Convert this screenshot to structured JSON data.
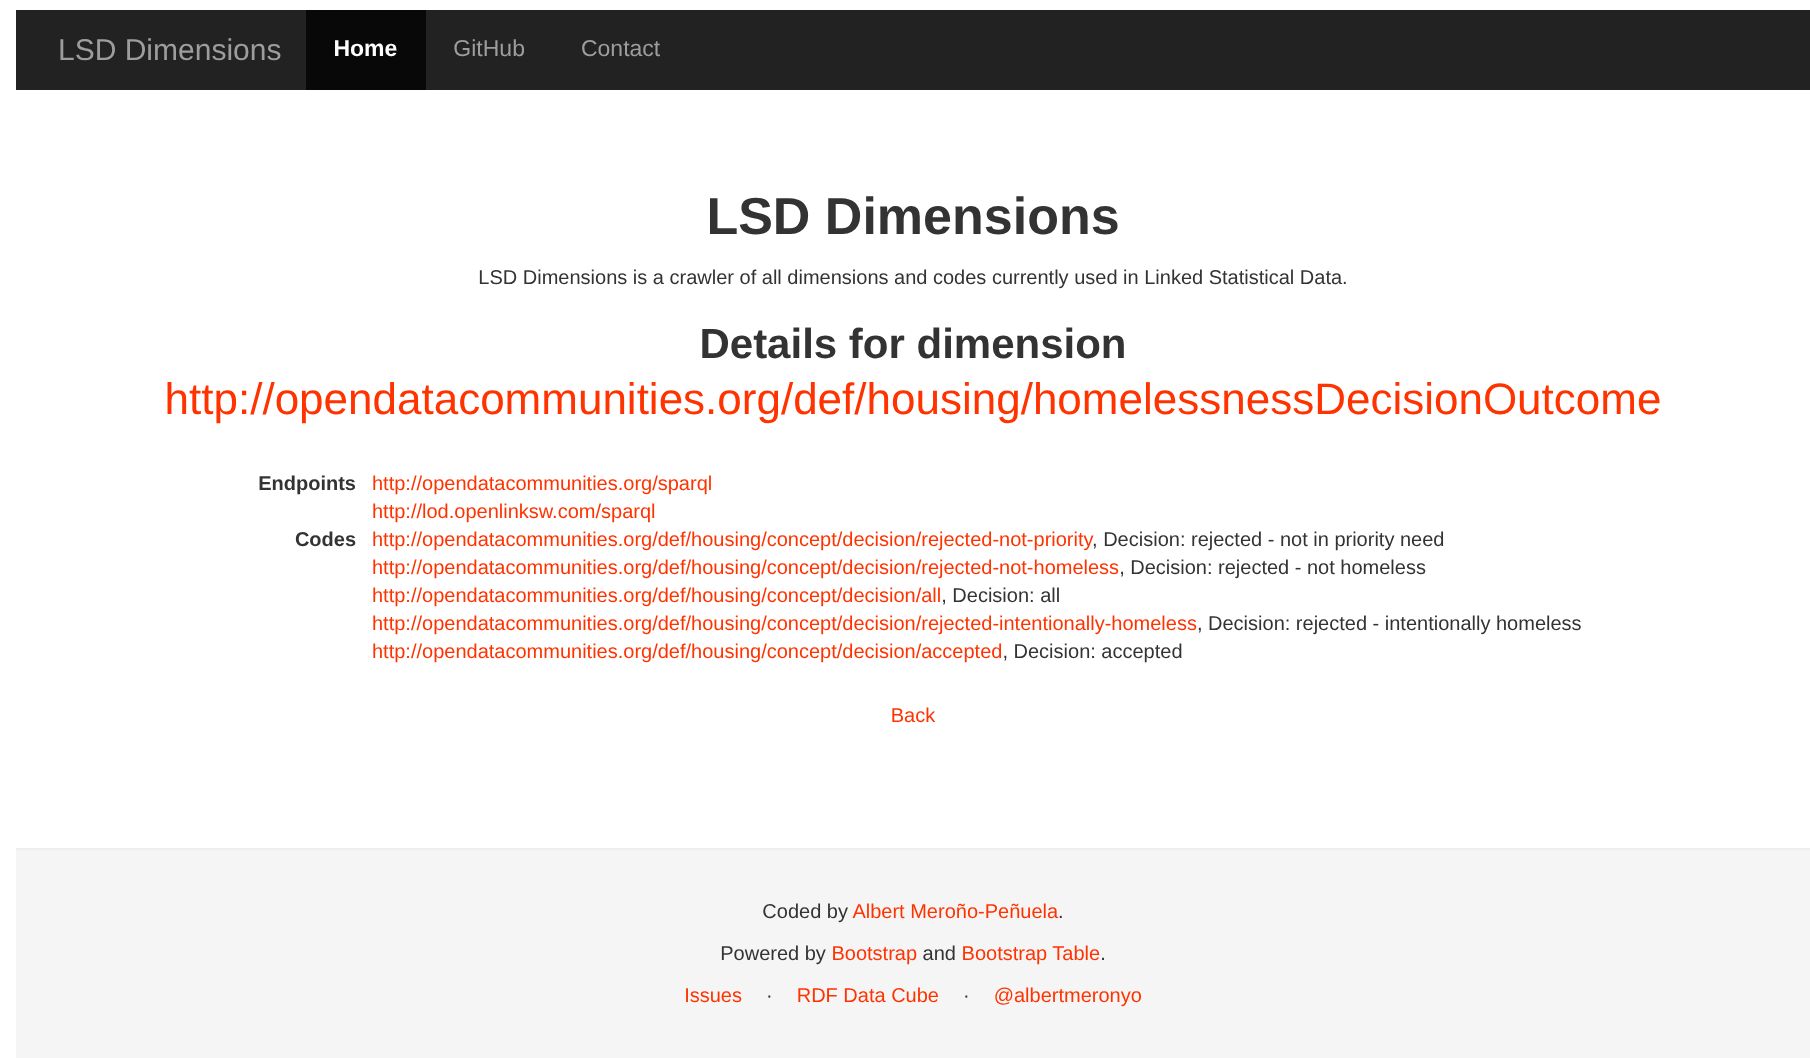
{
  "navbar": {
    "brand": "LSD Dimensions",
    "items": [
      {
        "label": "Home",
        "selected": true
      },
      {
        "label": "GitHub",
        "selected": false
      },
      {
        "label": "Contact",
        "selected": false
      }
    ]
  },
  "header": {
    "title": "LSD Dimensions",
    "subtitle": "LSD Dimensions is a crawler of all dimensions and codes currently used in Linked Statistical Data."
  },
  "dimension": {
    "heading": "Details for dimension",
    "uri": "http://opendatacommunities.org/def/housing/homelessnessDecisionOutcome"
  },
  "details": {
    "endpoints_label": "Endpoints",
    "endpoints": [
      "http://opendatacommunities.org/sparql",
      "http://lod.openlinksw.com/sparql"
    ],
    "codes_label": "Codes",
    "codes": [
      {
        "uri": "http://opendatacommunities.org/def/housing/concept/decision/rejected-not-priority",
        "description": ", Decision: rejected - not in priority need"
      },
      {
        "uri": "http://opendatacommunities.org/def/housing/concept/decision/rejected-not-homeless",
        "description": ", Decision: rejected - not homeless"
      },
      {
        "uri": "http://opendatacommunities.org/def/housing/concept/decision/all",
        "description": ", Decision: all"
      },
      {
        "uri": "http://opendatacommunities.org/def/housing/concept/decision/rejected-intentionally-homeless",
        "description": ", Decision: rejected - intentionally homeless"
      },
      {
        "uri": "http://opendatacommunities.org/def/housing/concept/decision/accepted",
        "description": ", Decision: accepted"
      }
    ]
  },
  "back_link": "Back",
  "footer": {
    "lines": [
      [
        {
          "kind": "text",
          "text": "Coded by "
        },
        {
          "kind": "link",
          "text": "Albert Meroño-Peñuela"
        },
        {
          "kind": "text",
          "text": "."
        }
      ],
      [
        {
          "kind": "text",
          "text": "Powered by "
        },
        {
          "kind": "link",
          "text": "Bootstrap"
        },
        {
          "kind": "text",
          "text": " and "
        },
        {
          "kind": "link",
          "text": "Bootstrap Table"
        },
        {
          "kind": "text",
          "text": "."
        }
      ]
    ],
    "links": [
      {
        "kind": "link",
        "text": "Issues"
      },
      {
        "kind": "separator",
        "text": "·"
      },
      {
        "kind": "link",
        "text": "RDF Data Cube"
      },
      {
        "kind": "separator",
        "text": "·"
      },
      {
        "kind": "link",
        "text": "@albertmeronyo"
      }
    ]
  }
}
